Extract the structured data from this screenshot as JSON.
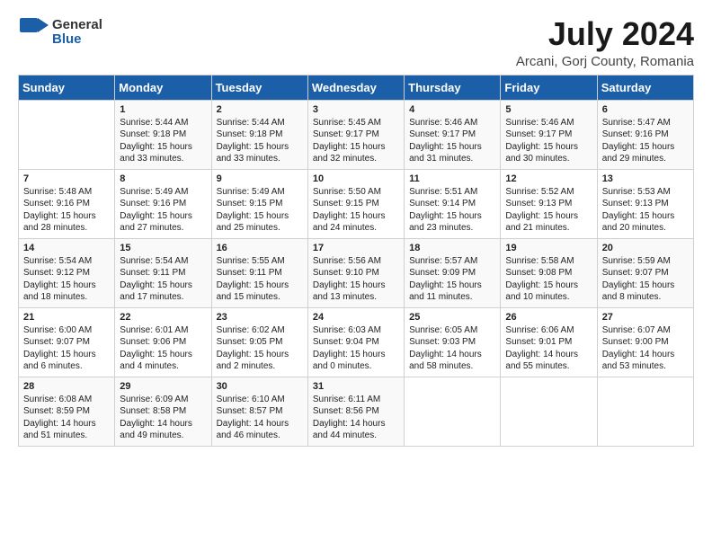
{
  "header": {
    "logo_line1": "General",
    "logo_line2": "Blue",
    "main_title": "July 2024",
    "subtitle": "Arcani, Gorj County, Romania"
  },
  "calendar": {
    "days_of_week": [
      "Sunday",
      "Monday",
      "Tuesday",
      "Wednesday",
      "Thursday",
      "Friday",
      "Saturday"
    ],
    "weeks": [
      [
        {
          "day": "",
          "info": ""
        },
        {
          "day": "1",
          "info": "Sunrise: 5:44 AM\nSunset: 9:18 PM\nDaylight: 15 hours\nand 33 minutes."
        },
        {
          "day": "2",
          "info": "Sunrise: 5:44 AM\nSunset: 9:18 PM\nDaylight: 15 hours\nand 33 minutes."
        },
        {
          "day": "3",
          "info": "Sunrise: 5:45 AM\nSunset: 9:17 PM\nDaylight: 15 hours\nand 32 minutes."
        },
        {
          "day": "4",
          "info": "Sunrise: 5:46 AM\nSunset: 9:17 PM\nDaylight: 15 hours\nand 31 minutes."
        },
        {
          "day": "5",
          "info": "Sunrise: 5:46 AM\nSunset: 9:17 PM\nDaylight: 15 hours\nand 30 minutes."
        },
        {
          "day": "6",
          "info": "Sunrise: 5:47 AM\nSunset: 9:16 PM\nDaylight: 15 hours\nand 29 minutes."
        }
      ],
      [
        {
          "day": "7",
          "info": "Sunrise: 5:48 AM\nSunset: 9:16 PM\nDaylight: 15 hours\nand 28 minutes."
        },
        {
          "day": "8",
          "info": "Sunrise: 5:49 AM\nSunset: 9:16 PM\nDaylight: 15 hours\nand 27 minutes."
        },
        {
          "day": "9",
          "info": "Sunrise: 5:49 AM\nSunset: 9:15 PM\nDaylight: 15 hours\nand 25 minutes."
        },
        {
          "day": "10",
          "info": "Sunrise: 5:50 AM\nSunset: 9:15 PM\nDaylight: 15 hours\nand 24 minutes."
        },
        {
          "day": "11",
          "info": "Sunrise: 5:51 AM\nSunset: 9:14 PM\nDaylight: 15 hours\nand 23 minutes."
        },
        {
          "day": "12",
          "info": "Sunrise: 5:52 AM\nSunset: 9:13 PM\nDaylight: 15 hours\nand 21 minutes."
        },
        {
          "day": "13",
          "info": "Sunrise: 5:53 AM\nSunset: 9:13 PM\nDaylight: 15 hours\nand 20 minutes."
        }
      ],
      [
        {
          "day": "14",
          "info": "Sunrise: 5:54 AM\nSunset: 9:12 PM\nDaylight: 15 hours\nand 18 minutes."
        },
        {
          "day": "15",
          "info": "Sunrise: 5:54 AM\nSunset: 9:11 PM\nDaylight: 15 hours\nand 17 minutes."
        },
        {
          "day": "16",
          "info": "Sunrise: 5:55 AM\nSunset: 9:11 PM\nDaylight: 15 hours\nand 15 minutes."
        },
        {
          "day": "17",
          "info": "Sunrise: 5:56 AM\nSunset: 9:10 PM\nDaylight: 15 hours\nand 13 minutes."
        },
        {
          "day": "18",
          "info": "Sunrise: 5:57 AM\nSunset: 9:09 PM\nDaylight: 15 hours\nand 11 minutes."
        },
        {
          "day": "19",
          "info": "Sunrise: 5:58 AM\nSunset: 9:08 PM\nDaylight: 15 hours\nand 10 minutes."
        },
        {
          "day": "20",
          "info": "Sunrise: 5:59 AM\nSunset: 9:07 PM\nDaylight: 15 hours\nand 8 minutes."
        }
      ],
      [
        {
          "day": "21",
          "info": "Sunrise: 6:00 AM\nSunset: 9:07 PM\nDaylight: 15 hours\nand 6 minutes."
        },
        {
          "day": "22",
          "info": "Sunrise: 6:01 AM\nSunset: 9:06 PM\nDaylight: 15 hours\nand 4 minutes."
        },
        {
          "day": "23",
          "info": "Sunrise: 6:02 AM\nSunset: 9:05 PM\nDaylight: 15 hours\nand 2 minutes."
        },
        {
          "day": "24",
          "info": "Sunrise: 6:03 AM\nSunset: 9:04 PM\nDaylight: 15 hours\nand 0 minutes."
        },
        {
          "day": "25",
          "info": "Sunrise: 6:05 AM\nSunset: 9:03 PM\nDaylight: 14 hours\nand 58 minutes."
        },
        {
          "day": "26",
          "info": "Sunrise: 6:06 AM\nSunset: 9:01 PM\nDaylight: 14 hours\nand 55 minutes."
        },
        {
          "day": "27",
          "info": "Sunrise: 6:07 AM\nSunset: 9:00 PM\nDaylight: 14 hours\nand 53 minutes."
        }
      ],
      [
        {
          "day": "28",
          "info": "Sunrise: 6:08 AM\nSunset: 8:59 PM\nDaylight: 14 hours\nand 51 minutes."
        },
        {
          "day": "29",
          "info": "Sunrise: 6:09 AM\nSunset: 8:58 PM\nDaylight: 14 hours\nand 49 minutes."
        },
        {
          "day": "30",
          "info": "Sunrise: 6:10 AM\nSunset: 8:57 PM\nDaylight: 14 hours\nand 46 minutes."
        },
        {
          "day": "31",
          "info": "Sunrise: 6:11 AM\nSunset: 8:56 PM\nDaylight: 14 hours\nand 44 minutes."
        },
        {
          "day": "",
          "info": ""
        },
        {
          "day": "",
          "info": ""
        },
        {
          "day": "",
          "info": ""
        }
      ]
    ]
  }
}
